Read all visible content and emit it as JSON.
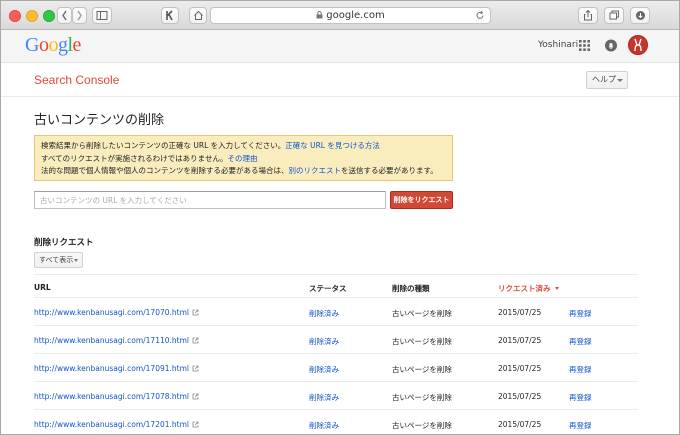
{
  "browser": {
    "address": "google.com"
  },
  "google_header": {
    "logo": [
      "G",
      "o",
      "o",
      "g",
      "l",
      "e"
    ],
    "logo_colors": [
      "#4285f4",
      "#ea4335",
      "#fbbc05",
      "#4285f4",
      "#34a853",
      "#ea4335"
    ],
    "user_name": "Yoshinari"
  },
  "console": {
    "title": "Search Console",
    "help_label": "ヘルプ"
  },
  "main": {
    "page_title": "古いコンテンツの削除",
    "notice": {
      "line1_text": "検索結果から削除したいコンテンツの正確な URL を入力してください。",
      "line1_link": "正確な URL を見つける方法",
      "line2_text": "すべてのリクエストが実施されるわけではありません。",
      "line2_link": "その理由",
      "line3_text_a": "法的な問題で個人情報や個人のコンテンツを削除する必要がある場合は、",
      "line3_link": "別のリクエスト",
      "line3_text_b": "を送信する必要があります。"
    },
    "input_placeholder": "古いコンテンツの URL を入力してください",
    "submit_label": "削除をリクエスト",
    "section_title": "削除リクエスト",
    "filter_label": "すべて表示",
    "table": {
      "headers": {
        "url": "URL",
        "status": "ステータス",
        "type": "削除の種類",
        "date": "リクエスト済み"
      },
      "rows": [
        {
          "url": "http://www.kenbanusagi.com/17070.html",
          "status": "削除済み",
          "type": "古いページを削除",
          "date": "2015/07/25",
          "action": "再登録"
        },
        {
          "url": "http://www.kenbanusagi.com/17110.html",
          "status": "削除済み",
          "type": "古いページを削除",
          "date": "2015/07/25",
          "action": "再登録"
        },
        {
          "url": "http://www.kenbanusagi.com/17091.html",
          "status": "削除済み",
          "type": "古いページを削除",
          "date": "2015/07/25",
          "action": "再登録"
        },
        {
          "url": "http://www.kenbanusagi.com/17078.html",
          "status": "削除済み",
          "type": "古いページを削除",
          "date": "2015/07/25",
          "action": "再登録"
        },
        {
          "url": "http://www.kenbanusagi.com/17201.html",
          "status": "削除済み",
          "type": "古いページを削除",
          "date": "2015/07/25",
          "action": "再登録"
        }
      ]
    }
  }
}
